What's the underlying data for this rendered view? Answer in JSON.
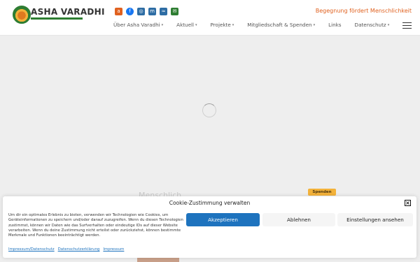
{
  "header": {
    "brand": "ASHA VARADHI",
    "tagline": "Begegnung fördert Menschlichkeit",
    "right_text": "Begegnung fördert Menschlichkeit",
    "socials": [
      {
        "icon": "feed-icon",
        "glyph": "a",
        "color": "#e0611f"
      },
      {
        "icon": "facebook-icon",
        "glyph": "f",
        "color": "#1877f2"
      },
      {
        "icon": "instagram-icon",
        "glyph": "◎",
        "color": "#2e6da4"
      },
      {
        "icon": "mastodon-icon",
        "glyph": "m",
        "color": "#2e6da4"
      },
      {
        "icon": "rss-icon",
        "glyph": "≈",
        "color": "#2e6da4"
      },
      {
        "icon": "mail-icon",
        "glyph": "✉",
        "color": "#2e7d32"
      }
    ],
    "nav": [
      {
        "label": "Über Asha Varadhi",
        "dropdown": true
      },
      {
        "label": "Aktuell",
        "dropdown": true
      },
      {
        "label": "Projekte",
        "dropdown": true
      },
      {
        "label": "Mitgliedschaft & Spenden",
        "dropdown": true
      },
      {
        "label": "Links",
        "dropdown": false
      },
      {
        "label": "Datenschutz",
        "dropdown": true
      }
    ],
    "caret": "▾"
  },
  "main": {
    "ghost_text": "Menschlich",
    "spenden_label": "Spenden"
  },
  "cookie": {
    "title": "Cookie-Zustimmung verwalten",
    "close_glyph": "×",
    "text": "Um dir ein optimales Erlebnis zu bieten, verwenden wir Technologien wie Cookies, um Geräteinformationen zu speichern und/oder darauf zuzugreifen. Wenn du diesen Technologien zustimmst, können wir Daten wie das Surfverhalten oder eindeutige IDs auf dieser Website verarbeiten. Wenn du deine Zustimmung nicht erteilst oder zurückziehst, können bestimmte Merkmale und Funktionen beeinträchtigt werden.",
    "accept": "Akzeptieren",
    "decline": "Ablehnen",
    "settings": "Einstellungen ansehen",
    "links": [
      "Impressum/Datenschutz",
      "Datenschutzerklärung",
      "Impressum"
    ]
  }
}
